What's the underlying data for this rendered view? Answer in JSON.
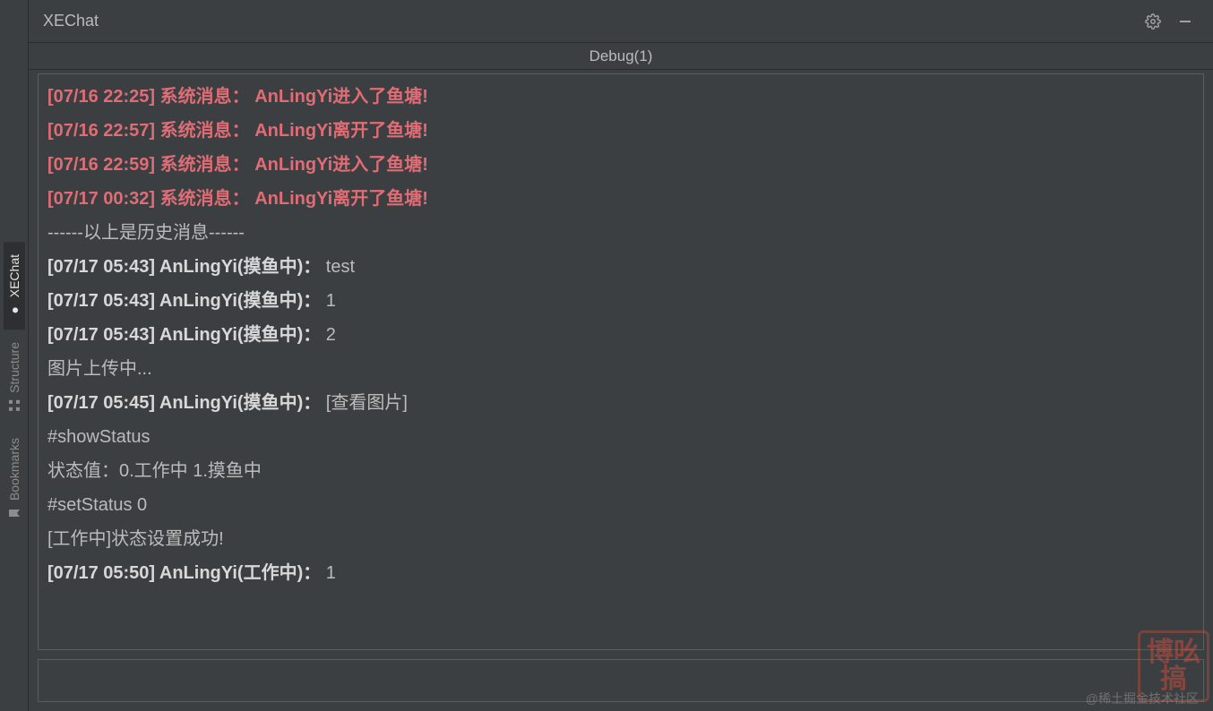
{
  "window": {
    "title": "XEChat"
  },
  "sidebar": {
    "tabs": [
      {
        "label": "XEChat",
        "icon": "chat-dot",
        "active": true
      },
      {
        "label": "Structure",
        "icon": "structure",
        "active": false
      },
      {
        "label": "Bookmarks",
        "icon": "bookmark",
        "active": false
      }
    ]
  },
  "tabbar": {
    "current": "Debug(1)"
  },
  "log": {
    "lines": [
      {
        "type": "sys",
        "text": "[07/16 22:25] 系统消息： AnLingYi进入了鱼塘!"
      },
      {
        "type": "sys",
        "text": "[07/16 22:57] 系统消息： AnLingYi离开了鱼塘!"
      },
      {
        "type": "sys",
        "text": "[07/16 22:59] 系统消息： AnLingYi进入了鱼塘!"
      },
      {
        "type": "sys",
        "text": "[07/17 00:32] 系统消息： AnLingYi离开了鱼塘!"
      },
      {
        "type": "divider",
        "text": "------以上是历史消息------"
      },
      {
        "type": "msg",
        "prefix": "[07/17 05:43] AnLingYi(摸鱼中)：",
        "body": " test"
      },
      {
        "type": "msg",
        "prefix": "[07/17 05:43] AnLingYi(摸鱼中)：",
        "body": " 1"
      },
      {
        "type": "msg",
        "prefix": "[07/17 05:43] AnLingYi(摸鱼中)：",
        "body": " 2"
      },
      {
        "type": "plain",
        "text": "图片上传中..."
      },
      {
        "type": "msg",
        "prefix": "[07/17 05:45] AnLingYi(摸鱼中)：",
        "body": " [查看图片]"
      },
      {
        "type": "plain",
        "text": "#showStatus"
      },
      {
        "type": "plain",
        "text": "状态值：0.工作中 1.摸鱼中"
      },
      {
        "type": "plain",
        "text": "#setStatus 0"
      },
      {
        "type": "plain",
        "text": "[工作中]状态设置成功!"
      },
      {
        "type": "msg",
        "prefix": "[07/17 05:50] AnLingYi(工作中)：",
        "body": " 1"
      }
    ]
  },
  "input": {
    "value": "",
    "placeholder": ""
  },
  "watermark": "@稀土掘金技术社区",
  "stamp": "博吆搞"
}
